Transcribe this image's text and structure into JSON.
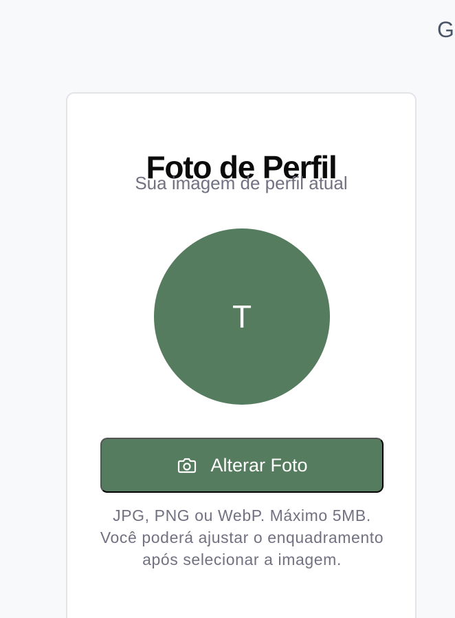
{
  "header": {
    "clipped_text": "G"
  },
  "profile_photo": {
    "title": "Foto de Perfil",
    "subtitle": "Sua imagem de perfil atual",
    "avatar_initial": "T",
    "change_button_label": "Alterar Foto",
    "help_text": "JPG, PNG ou WebP. Máximo 5MB. Você poderá ajustar o enquadramento após selecionar a imagem."
  },
  "icons": {
    "change_button_icon": "camera-icon"
  },
  "colors": {
    "page_background": "#f8f9fb",
    "card_background": "#ffffff",
    "accent": "#557c5e",
    "title_text": "#0b0b0b",
    "muted_text": "#717182"
  }
}
